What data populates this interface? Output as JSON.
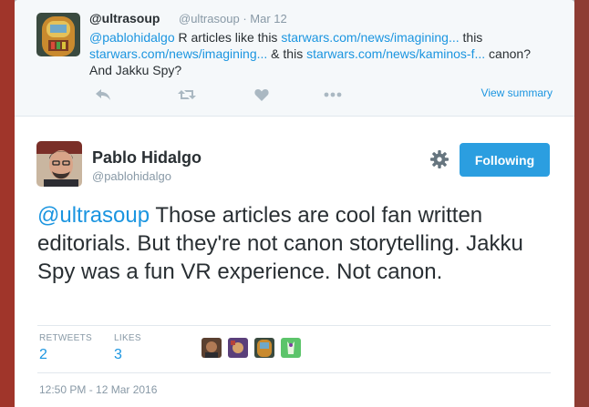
{
  "parent_tweet": {
    "name": "@ultrasoup",
    "handle": "@ultrasoup",
    "separator": "·",
    "date": "Mar 12",
    "mention": "@pablohidalgo",
    "text_1": " R articles like this ",
    "link_1": "starwars.com/news/imagining...",
    "text_2": " this ",
    "link_2": "starwars.com/news/imagining...",
    "text_3": " & this ",
    "link_3": "starwars.com/news/kaminos-f...",
    "text_4": " canon? And Jakku Spy?",
    "view_summary": "View summary",
    "actions": [
      "reply-icon",
      "retweet-icon",
      "like-icon",
      "more-icon"
    ]
  },
  "main_tweet": {
    "name": "Pablo Hidalgo",
    "handle": "@pablohidalgo",
    "follow_label": "Following",
    "mention": "@ultrasoup",
    "text": " Those articles are cool fan written editorials. But they're not canon storytelling. Jakku Spy was a fun VR experience. Not canon.",
    "retweets_label": "RETWEETS",
    "retweets_count": "2",
    "likes_label": "LIKES",
    "likes_count": "3",
    "timestamp": "12:50 PM - 12 Mar 2016"
  },
  "colors": {
    "link": "#1b95e0",
    "follow_button": "#2b9ee0",
    "muted": "#8899a6",
    "text": "#292f33"
  }
}
